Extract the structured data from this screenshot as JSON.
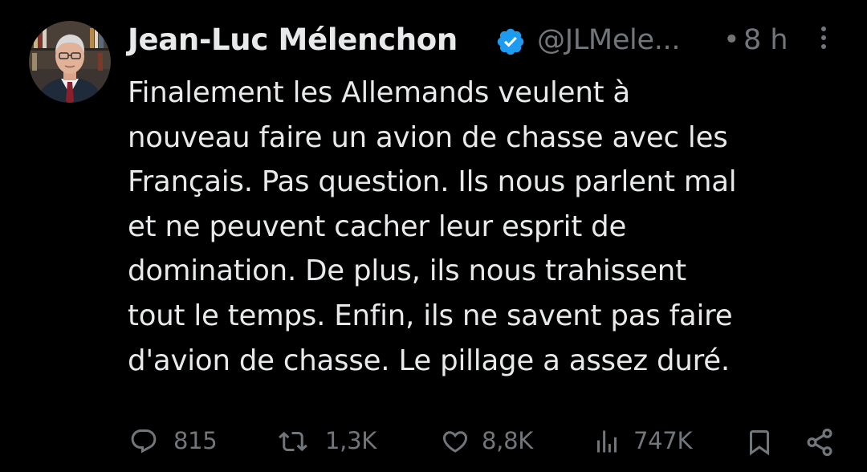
{
  "tweet": {
    "author": {
      "display_name": "Jean-Luc Mélenchon",
      "handle": "@JLMele...",
      "verified_icon": "verified-badge-icon",
      "verified_color": "#1d9bf0"
    },
    "separator": "•",
    "time": "8 h",
    "text_lines": [
      "Finalement les Allemands veulent à",
      "nouveau faire un avion de chasse avec les",
      "Français. Pas question. Ils nous parlent mal",
      "et ne peuvent cacher leur esprit de",
      "domination. De plus, ils nous trahissent",
      "tout le temps. Enfin, ils ne savent pas faire",
      "d'avion de chasse. Le pillage a assez duré."
    ],
    "actions": {
      "reply": {
        "icon": "reply-icon",
        "count": "815"
      },
      "retweet": {
        "icon": "retweet-icon",
        "count": "1,3K"
      },
      "like": {
        "icon": "heart-icon",
        "count": "8,8K"
      },
      "views": {
        "icon": "views-icon",
        "count": "747K"
      },
      "bookmark": {
        "icon": "bookmark-icon"
      },
      "share": {
        "icon": "share-icon"
      }
    },
    "colors": {
      "background": "#000000",
      "text": "#e7e9ea",
      "secondary": "#71767b"
    }
  }
}
